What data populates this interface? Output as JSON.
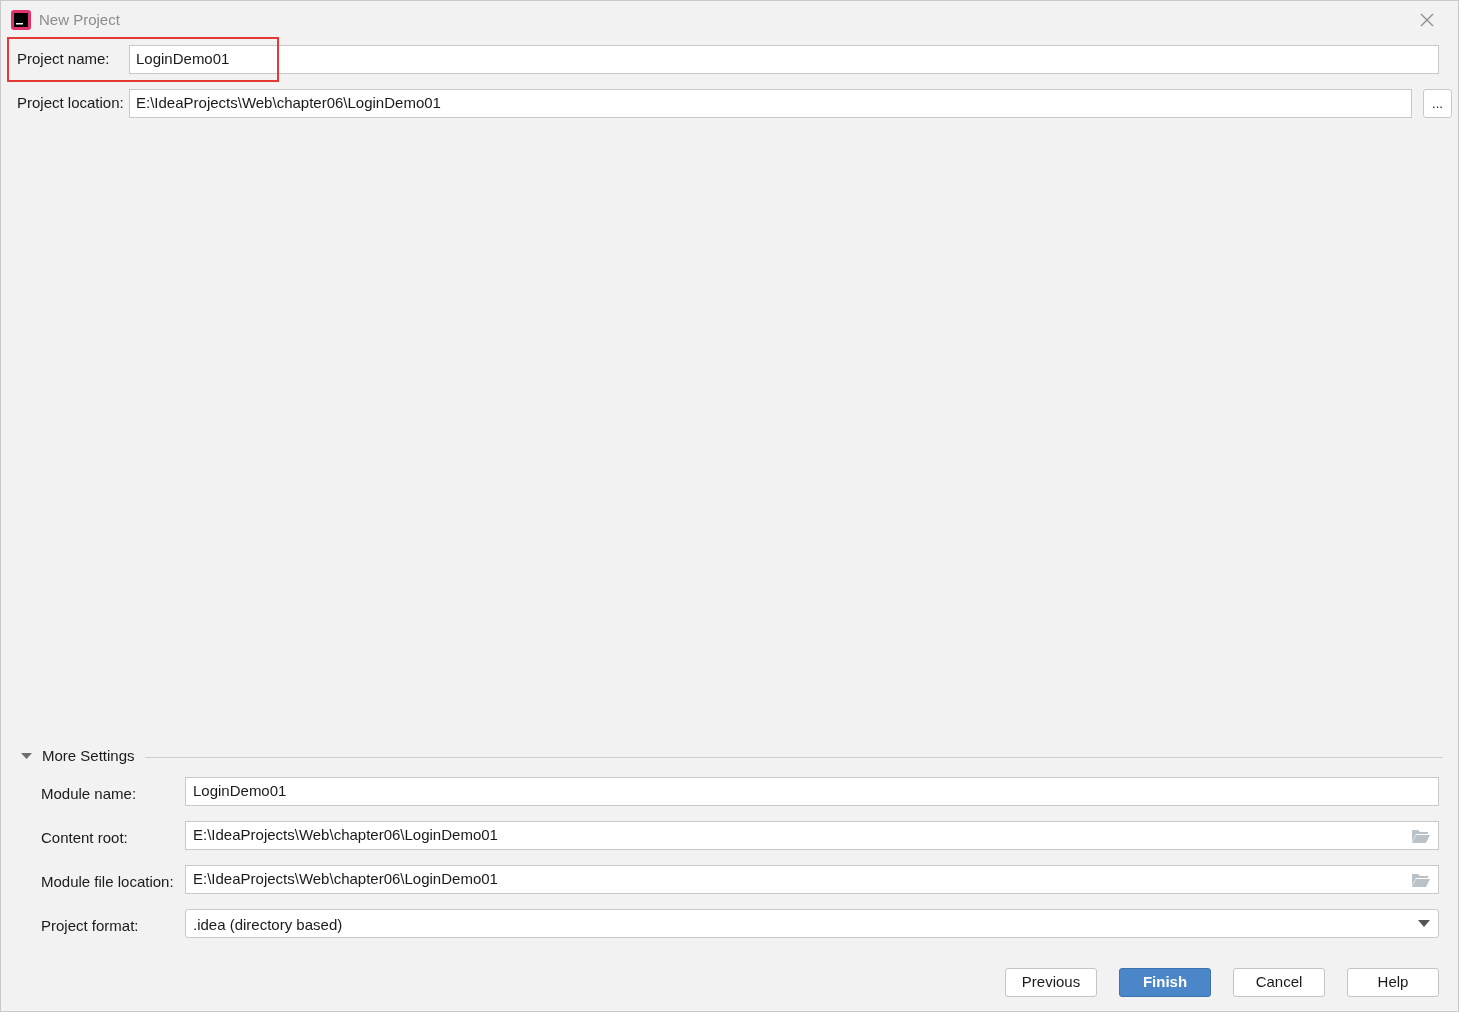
{
  "window": {
    "title": "New Project"
  },
  "top_fields": [
    {
      "label": "Project name:",
      "value": "LoginDemo01",
      "highlighted": true,
      "browse": false
    },
    {
      "label": "Project location:",
      "value": "E:\\IdeaProjects\\Web\\chapter06\\LoginDemo01",
      "highlighted": false,
      "browse": true,
      "browse_label": "..."
    }
  ],
  "more_settings": {
    "label": "More Settings",
    "expanded": true,
    "fields": [
      {
        "kind": "text",
        "label": "Module name:",
        "value": "LoginDemo01"
      },
      {
        "kind": "path",
        "label": "Content root:",
        "value": "E:\\IdeaProjects\\Web\\chapter06\\LoginDemo01"
      },
      {
        "kind": "path",
        "label": "Module file location:",
        "value": "E:\\IdeaProjects\\Web\\chapter06\\LoginDemo01"
      },
      {
        "kind": "dropdown",
        "label": "Project format:",
        "value": ".idea (directory based)"
      }
    ]
  },
  "buttons": [
    {
      "label": "Previous",
      "default": false
    },
    {
      "label": "Finish",
      "default": true
    },
    {
      "label": "Cancel",
      "default": false
    },
    {
      "label": "Help",
      "default": false
    }
  ]
}
